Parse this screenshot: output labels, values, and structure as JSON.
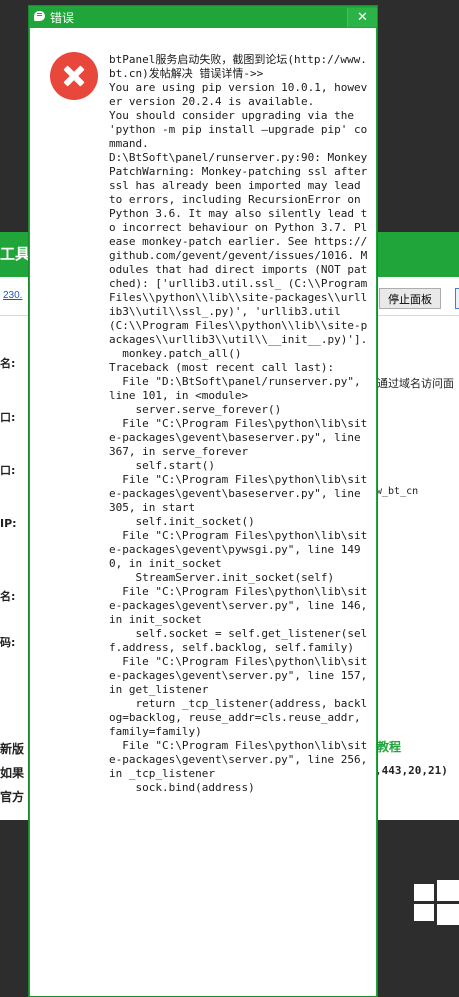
{
  "background_app": {
    "title": "工具",
    "link": "230.",
    "stop_panel_button": "停止面板",
    "form_labels": [
      "名:",
      "口:",
      "口:",
      "IP:",
      "名:",
      "码:"
    ],
    "domain_hint": "通过域名访问面",
    "path_hint": "w_bt_cn",
    "bottom_labels": [
      "新版",
      "如果",
      "官方"
    ],
    "tutorial_text": "教程",
    "ports_text": ",443,20,21)"
  },
  "dialog": {
    "title": "错误",
    "close_symbol": "✕",
    "message": "btPanel服务启动失败，截图到论坛(http://www.bt.cn)发帖解决 错误详情->>\nYou are using pip version 10.0.1, however version 20.2.4 is available.\nYou should consider upgrading via the 'python -m pip install —upgrade pip' command.\nD:\\BtSoft\\panel/runserver.py:90: MonkeyPatchWarning: Monkey-patching ssl after ssl has already been imported may lead to errors, including RecursionError on Python 3.6. It may also silently lead to incorrect behaviour on Python 3.7. Please monkey-patch earlier. See https://github.com/gevent/gevent/issues/1016. Modules that had direct imports (NOT patched): ['urllib3.util.ssl_ (C:\\\\Program Files\\\\python\\\\lib\\\\site-packages\\\\urllib3\\\\util\\\\ssl_.py)', 'urllib3.util (C:\\\\Program Files\\\\python\\\\lib\\\\site-packages\\\\urllib3\\\\util\\\\__init__.py)'].\n  monkey.patch_all()\nTraceback (most recent call last):\n  File \"D:\\BtSoft\\panel/runserver.py\", line 101, in <module>\n    server.serve_forever()\n  File \"C:\\Program Files\\python\\lib\\site-packages\\gevent\\baseserver.py\", line 367, in serve_forever\n    self.start()\n  File \"C:\\Program Files\\python\\lib\\site-packages\\gevent\\baseserver.py\", line 305, in start\n    self.init_socket()\n  File \"C:\\Program Files\\python\\lib\\site-packages\\gevent\\pywsgi.py\", line 1490, in init_socket\n    StreamServer.init_socket(self)\n  File \"C:\\Program Files\\python\\lib\\site-packages\\gevent\\server.py\", line 146, in init_socket\n    self.socket = self.get_listener(self.address, self.backlog, self.family)\n  File \"C:\\Program Files\\python\\lib\\site-packages\\gevent\\server.py\", line 157, in get_listener\n    return _tcp_listener(address, backlog=backlog, reuse_addr=cls.reuse_addr, family=family)\n  File \"C:\\Program Files\\python\\lib\\site-packages\\gevent\\server.py\", line 256, in _tcp_listener\n    sock.bind(address)"
  },
  "colors": {
    "accent_green": "#20a53a",
    "error_red": "#e8473b",
    "link_blue": "#1a55c6"
  }
}
